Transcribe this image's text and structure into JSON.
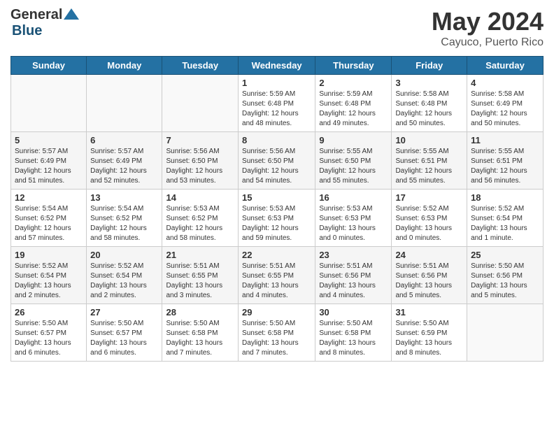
{
  "logo": {
    "general": "General",
    "blue": "Blue"
  },
  "title": "May 2024",
  "subtitle": "Cayuco, Puerto Rico",
  "days_header": [
    "Sunday",
    "Monday",
    "Tuesday",
    "Wednesday",
    "Thursday",
    "Friday",
    "Saturday"
  ],
  "weeks": [
    [
      {
        "num": "",
        "info": ""
      },
      {
        "num": "",
        "info": ""
      },
      {
        "num": "",
        "info": ""
      },
      {
        "num": "1",
        "info": "Sunrise: 5:59 AM\nSunset: 6:48 PM\nDaylight: 12 hours\nand 48 minutes."
      },
      {
        "num": "2",
        "info": "Sunrise: 5:59 AM\nSunset: 6:48 PM\nDaylight: 12 hours\nand 49 minutes."
      },
      {
        "num": "3",
        "info": "Sunrise: 5:58 AM\nSunset: 6:48 PM\nDaylight: 12 hours\nand 50 minutes."
      },
      {
        "num": "4",
        "info": "Sunrise: 5:58 AM\nSunset: 6:49 PM\nDaylight: 12 hours\nand 50 minutes."
      }
    ],
    [
      {
        "num": "5",
        "info": "Sunrise: 5:57 AM\nSunset: 6:49 PM\nDaylight: 12 hours\nand 51 minutes."
      },
      {
        "num": "6",
        "info": "Sunrise: 5:57 AM\nSunset: 6:49 PM\nDaylight: 12 hours\nand 52 minutes."
      },
      {
        "num": "7",
        "info": "Sunrise: 5:56 AM\nSunset: 6:50 PM\nDaylight: 12 hours\nand 53 minutes."
      },
      {
        "num": "8",
        "info": "Sunrise: 5:56 AM\nSunset: 6:50 PM\nDaylight: 12 hours\nand 54 minutes."
      },
      {
        "num": "9",
        "info": "Sunrise: 5:55 AM\nSunset: 6:50 PM\nDaylight: 12 hours\nand 55 minutes."
      },
      {
        "num": "10",
        "info": "Sunrise: 5:55 AM\nSunset: 6:51 PM\nDaylight: 12 hours\nand 55 minutes."
      },
      {
        "num": "11",
        "info": "Sunrise: 5:55 AM\nSunset: 6:51 PM\nDaylight: 12 hours\nand 56 minutes."
      }
    ],
    [
      {
        "num": "12",
        "info": "Sunrise: 5:54 AM\nSunset: 6:52 PM\nDaylight: 12 hours\nand 57 minutes."
      },
      {
        "num": "13",
        "info": "Sunrise: 5:54 AM\nSunset: 6:52 PM\nDaylight: 12 hours\nand 58 minutes."
      },
      {
        "num": "14",
        "info": "Sunrise: 5:53 AM\nSunset: 6:52 PM\nDaylight: 12 hours\nand 58 minutes."
      },
      {
        "num": "15",
        "info": "Sunrise: 5:53 AM\nSunset: 6:53 PM\nDaylight: 12 hours\nand 59 minutes."
      },
      {
        "num": "16",
        "info": "Sunrise: 5:53 AM\nSunset: 6:53 PM\nDaylight: 13 hours\nand 0 minutes."
      },
      {
        "num": "17",
        "info": "Sunrise: 5:52 AM\nSunset: 6:53 PM\nDaylight: 13 hours\nand 0 minutes."
      },
      {
        "num": "18",
        "info": "Sunrise: 5:52 AM\nSunset: 6:54 PM\nDaylight: 13 hours\nand 1 minute."
      }
    ],
    [
      {
        "num": "19",
        "info": "Sunrise: 5:52 AM\nSunset: 6:54 PM\nDaylight: 13 hours\nand 2 minutes."
      },
      {
        "num": "20",
        "info": "Sunrise: 5:52 AM\nSunset: 6:54 PM\nDaylight: 13 hours\nand 2 minutes."
      },
      {
        "num": "21",
        "info": "Sunrise: 5:51 AM\nSunset: 6:55 PM\nDaylight: 13 hours\nand 3 minutes."
      },
      {
        "num": "22",
        "info": "Sunrise: 5:51 AM\nSunset: 6:55 PM\nDaylight: 13 hours\nand 4 minutes."
      },
      {
        "num": "23",
        "info": "Sunrise: 5:51 AM\nSunset: 6:56 PM\nDaylight: 13 hours\nand 4 minutes."
      },
      {
        "num": "24",
        "info": "Sunrise: 5:51 AM\nSunset: 6:56 PM\nDaylight: 13 hours\nand 5 minutes."
      },
      {
        "num": "25",
        "info": "Sunrise: 5:50 AM\nSunset: 6:56 PM\nDaylight: 13 hours\nand 5 minutes."
      }
    ],
    [
      {
        "num": "26",
        "info": "Sunrise: 5:50 AM\nSunset: 6:57 PM\nDaylight: 13 hours\nand 6 minutes."
      },
      {
        "num": "27",
        "info": "Sunrise: 5:50 AM\nSunset: 6:57 PM\nDaylight: 13 hours\nand 6 minutes."
      },
      {
        "num": "28",
        "info": "Sunrise: 5:50 AM\nSunset: 6:58 PM\nDaylight: 13 hours\nand 7 minutes."
      },
      {
        "num": "29",
        "info": "Sunrise: 5:50 AM\nSunset: 6:58 PM\nDaylight: 13 hours\nand 7 minutes."
      },
      {
        "num": "30",
        "info": "Sunrise: 5:50 AM\nSunset: 6:58 PM\nDaylight: 13 hours\nand 8 minutes."
      },
      {
        "num": "31",
        "info": "Sunrise: 5:50 AM\nSunset: 6:59 PM\nDaylight: 13 hours\nand 8 minutes."
      },
      {
        "num": "",
        "info": ""
      }
    ]
  ]
}
